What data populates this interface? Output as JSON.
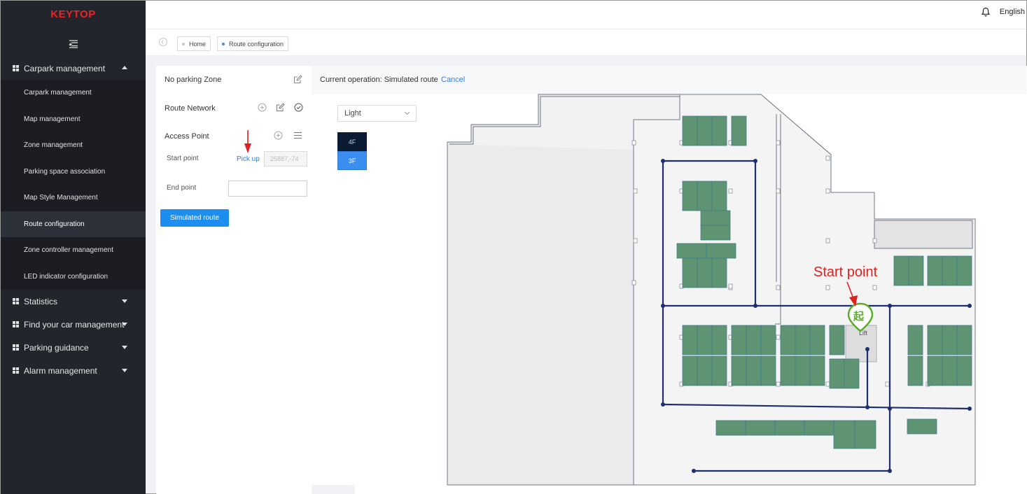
{
  "app": {
    "logo": "KEYTOP"
  },
  "topbar": {
    "language": "English"
  },
  "breadcrumb": {
    "tabs": [
      {
        "label": "Home"
      },
      {
        "label": "Route configuration"
      }
    ]
  },
  "sidebar": {
    "groups": [
      {
        "label": "Carpark management",
        "expanded": true
      },
      {
        "label": "Statistics",
        "expanded": false
      },
      {
        "label": "Find your car management",
        "expanded": false
      },
      {
        "label": "Parking guidance",
        "expanded": false
      },
      {
        "label": "Alarm management",
        "expanded": false
      }
    ],
    "submenu": [
      {
        "label": "Carpark management"
      },
      {
        "label": "Map management"
      },
      {
        "label": "Zone management"
      },
      {
        "label": "Parking space association"
      },
      {
        "label": "Map Style Management"
      },
      {
        "label": "Route configuration",
        "active": true
      },
      {
        "label": "Zone controller management"
      },
      {
        "label": "LED indicator configuration"
      }
    ]
  },
  "panel": {
    "no_parking_zone": "No parking Zone",
    "route_network": "Route Network",
    "access_point": "Access Point",
    "start_point": "Start point",
    "pick_up": "Pick up",
    "start_value": "25887,-74",
    "end_point": "End point",
    "end_value": "",
    "simulated_route_button": "Simulated route"
  },
  "map": {
    "operation_text": "Current operation: Simulated route",
    "cancel": "Cancel",
    "style_select": "Light",
    "floors": [
      {
        "label": "4F"
      },
      {
        "label": "3F",
        "selected": true
      }
    ],
    "annotation": "Start point",
    "start_marker_glyph": "起",
    "lift_label": "Lift"
  },
  "colors": {
    "sidebar_bg": "#22252b",
    "accent": "#1e8df0",
    "logo": "#e8232a",
    "parking_space": "#5f9472",
    "route_line": "#1e2f6e",
    "annotation": "#e02020",
    "start_marker": "#5aac2a"
  },
  "icons": [
    "menu-collapse-icon",
    "bell-icon",
    "grid-icon",
    "caret-icon",
    "edit-icon",
    "add-circle-icon",
    "check-circle-icon",
    "list-icon",
    "back-icon",
    "chevron-down-icon",
    "start-marker-icon",
    "arrow-annotation-icon"
  ]
}
